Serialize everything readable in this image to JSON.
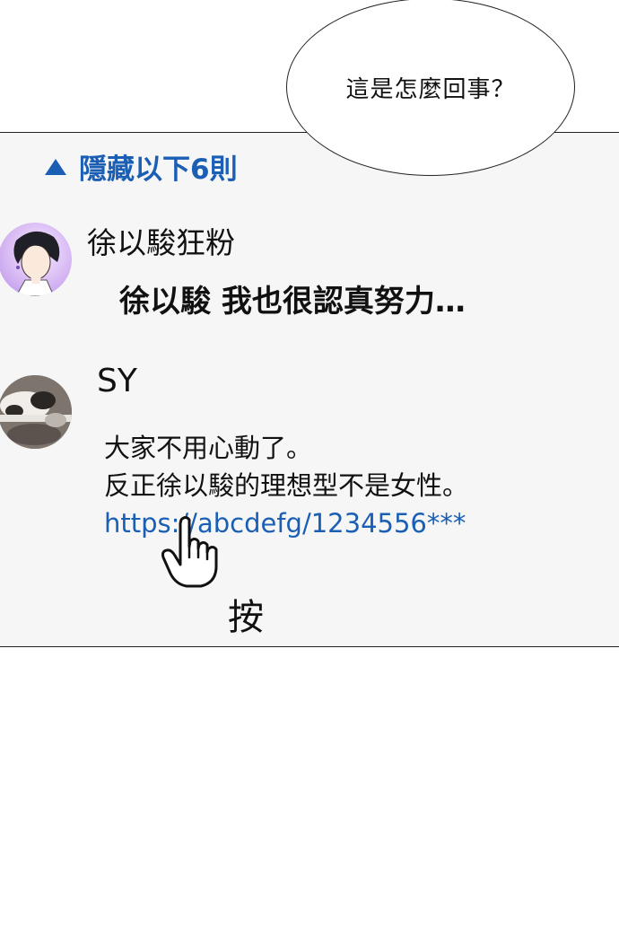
{
  "speech_bubble": {
    "text": "這是怎麼回事？"
  },
  "comments_panel": {
    "hide_replies_label": "隱藏以下6則",
    "comments": [
      {
        "username": "徐以駿狂粉",
        "text": "徐以駿 我也很認真努力…"
      },
      {
        "username": "SY",
        "lines": [
          "大家不用心動了。",
          "反正徐以駿的理想型不是女性。"
        ],
        "link": "https://abcdefg/1234556***"
      }
    ]
  },
  "sound_effect": "按",
  "colors": {
    "link_blue": "#1a5fb4",
    "panel_bg": "#f6f6f6",
    "border": "#222222"
  },
  "icons": {
    "collapse": "triangle-up-icon",
    "pointer": "hand-pointer-icon"
  }
}
